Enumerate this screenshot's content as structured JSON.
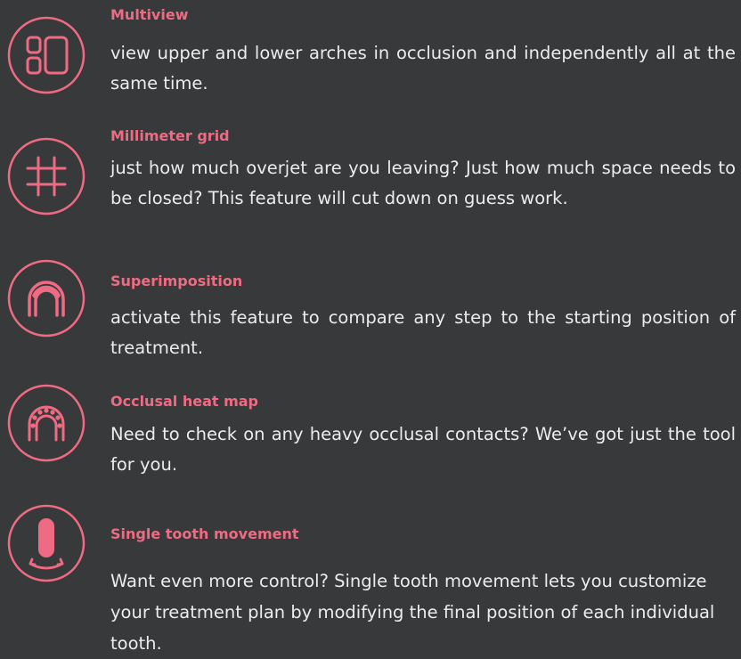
{
  "colors": {
    "background": "#37393a",
    "accent": "#ef6b84",
    "text": "#ececec"
  },
  "features": [
    {
      "icon": "multiview-icon",
      "title": "Multiview",
      "description": "view upper and lower arches in occlusion and independently all at the same time."
    },
    {
      "icon": "grid-icon",
      "title": "Millimeter grid",
      "description": "just how much overjet are you leaving? Just how much space needs to be closed? This feature will cut down on guess work."
    },
    {
      "icon": "superimposition-icon",
      "title": "Superimposition",
      "description": "activate this feature to compare any step to the starting position of treatment."
    },
    {
      "icon": "heat-map-icon",
      "title": "Occlusal heat map",
      "description": "Need to check on any heavy occlusal contacts? We’ve got just the tool for you."
    },
    {
      "icon": "tooth-movement-icon",
      "title": "Single tooth movement",
      "description": "Want even more control? Single tooth movement lets you customize your treatment plan by modifying the final position of each individual tooth."
    }
  ]
}
